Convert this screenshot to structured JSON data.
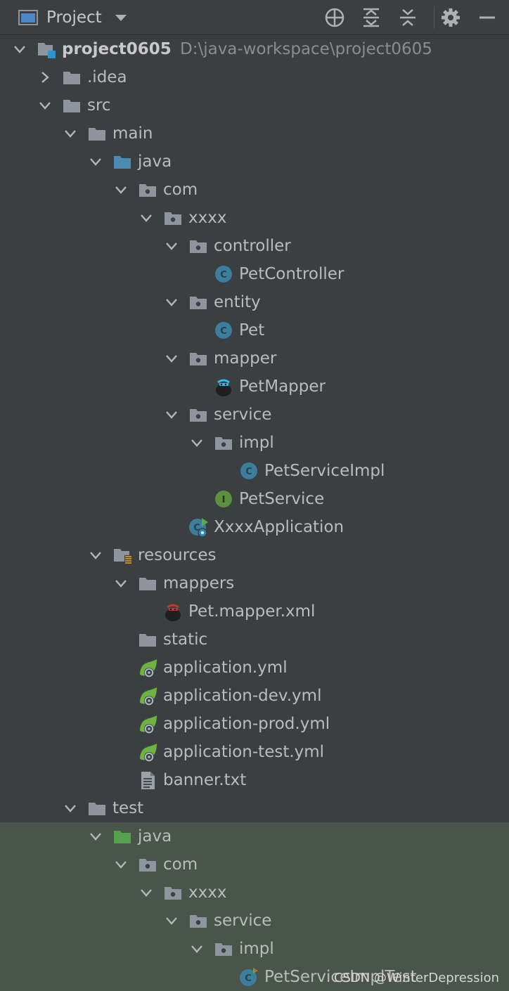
{
  "header": {
    "title": "Project"
  },
  "tree": [
    {
      "label": "project0605",
      "path": "D:\\java-workspace\\project0605",
      "bold": true,
      "depth": 0,
      "arrow": "down",
      "icon": "module-folder"
    },
    {
      "label": ".idea",
      "depth": 1,
      "arrow": "right",
      "icon": "folder"
    },
    {
      "label": "src",
      "depth": 1,
      "arrow": "down",
      "icon": "folder"
    },
    {
      "label": "main",
      "depth": 2,
      "arrow": "down",
      "icon": "folder"
    },
    {
      "label": "java",
      "depth": 3,
      "arrow": "down",
      "icon": "source-folder"
    },
    {
      "label": "com",
      "depth": 4,
      "arrow": "down",
      "icon": "package"
    },
    {
      "label": "xxxx",
      "depth": 5,
      "arrow": "down",
      "icon": "package"
    },
    {
      "label": "controller",
      "depth": 6,
      "arrow": "down",
      "icon": "package"
    },
    {
      "label": "PetController",
      "depth": 7,
      "icon": "class"
    },
    {
      "label": "entity",
      "depth": 6,
      "arrow": "down",
      "icon": "package"
    },
    {
      "label": "Pet",
      "depth": 7,
      "icon": "class"
    },
    {
      "label": "mapper",
      "depth": 6,
      "arrow": "down",
      "icon": "package"
    },
    {
      "label": "PetMapper",
      "depth": 7,
      "icon": "mybatis-mapper"
    },
    {
      "label": "service",
      "depth": 6,
      "arrow": "down",
      "icon": "package"
    },
    {
      "label": "impl",
      "depth": 7,
      "arrow": "down",
      "icon": "package"
    },
    {
      "label": "PetServiceImpl",
      "depth": 8,
      "icon": "class"
    },
    {
      "label": "PetService",
      "depth": 7,
      "icon": "interface"
    },
    {
      "label": "XxxxApplication",
      "depth": 6,
      "icon": "spring-app-class"
    },
    {
      "label": "resources",
      "depth": 3,
      "arrow": "down",
      "icon": "resources-folder"
    },
    {
      "label": "mappers",
      "depth": 4,
      "arrow": "down",
      "icon": "folder"
    },
    {
      "label": "Pet.mapper.xml",
      "depth": 5,
      "icon": "mybatis-xml"
    },
    {
      "label": "static",
      "depth": 4,
      "icon": "folder"
    },
    {
      "label": "application.yml",
      "depth": 4,
      "icon": "spring-yml"
    },
    {
      "label": "application-dev.yml",
      "depth": 4,
      "icon": "spring-yml"
    },
    {
      "label": "application-prod.yml",
      "depth": 4,
      "icon": "spring-yml"
    },
    {
      "label": "application-test.yml",
      "depth": 4,
      "icon": "spring-yml"
    },
    {
      "label": "banner.txt",
      "depth": 4,
      "icon": "text-file"
    },
    {
      "label": "test",
      "depth": 2,
      "arrow": "down",
      "icon": "folder"
    },
    {
      "label": "java",
      "depth": 3,
      "arrow": "down",
      "icon": "test-source-folder"
    },
    {
      "label": "com",
      "depth": 4,
      "arrow": "down",
      "icon": "package"
    },
    {
      "label": "xxxx",
      "depth": 5,
      "arrow": "down",
      "icon": "package"
    },
    {
      "label": "service",
      "depth": 6,
      "arrow": "down",
      "icon": "package"
    },
    {
      "label": "impl",
      "depth": 7,
      "arrow": "down",
      "icon": "package"
    },
    {
      "label": "PetServiceImplTest",
      "depth": 8,
      "icon": "test-class"
    }
  ],
  "watermark": "CSDN @WinterDepression",
  "colors": {
    "background": "#3c3f41",
    "test_background": "#49544a",
    "folder": "#8e959c",
    "source_folder": "#4a8bb3",
    "test_folder": "#54a24d",
    "class": "#3c7e9c",
    "interface": "#5c8f3e",
    "spring": "#6db33f"
  }
}
